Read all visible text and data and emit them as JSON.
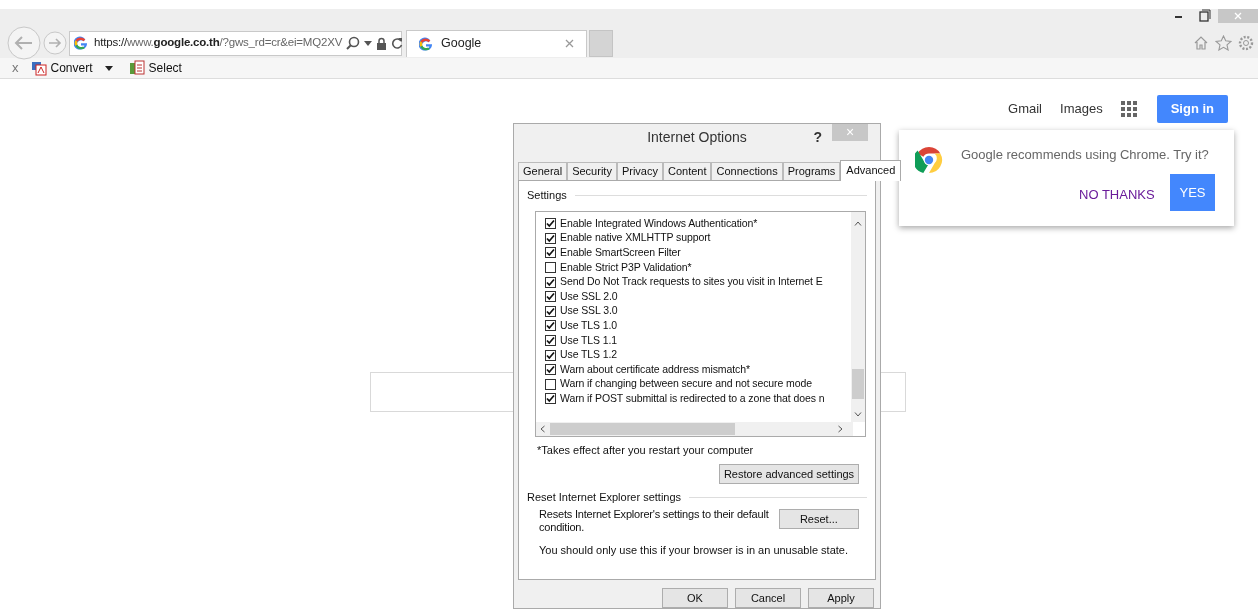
{
  "browser": {
    "address": {
      "scheme": "https://",
      "host_pre": "www.",
      "host": "google.co.th",
      "path": "/?gws_rd=cr&ei=MQ2XV"
    },
    "tabs": [
      {
        "title": "Google",
        "selected": true
      }
    ],
    "toolbar": [
      {
        "kind": "close",
        "label": "x"
      },
      {
        "kind": "convert",
        "label": "Convert"
      },
      {
        "kind": "select",
        "label": "Select"
      }
    ]
  },
  "google": {
    "links": [
      "Gmail",
      "Images"
    ],
    "sign_in": "Sign in",
    "promo": {
      "message": "Google recommends using Chrome. Try it?",
      "decline": "NO THANKS",
      "accept": "YES"
    }
  },
  "dialog": {
    "title": "Internet Options",
    "help": "?",
    "close": "×",
    "tabs": [
      {
        "label": "General",
        "selected": false
      },
      {
        "label": "Security",
        "selected": false
      },
      {
        "label": "Privacy",
        "selected": false
      },
      {
        "label": "Content",
        "selected": false
      },
      {
        "label": "Connections",
        "selected": false
      },
      {
        "label": "Programs",
        "selected": false
      },
      {
        "label": "Advanced",
        "selected": true
      }
    ],
    "settings_label": "Settings",
    "settings": [
      {
        "label": "Enable Integrated Windows Authentication*",
        "checked": true
      },
      {
        "label": "Enable native XMLHTTP support",
        "checked": true
      },
      {
        "label": "Enable SmartScreen Filter",
        "checked": true
      },
      {
        "label": "Enable Strict P3P Validation*",
        "checked": false
      },
      {
        "label": "Send Do Not Track requests to sites you visit in Internet E",
        "checked": true
      },
      {
        "label": "Use SSL 2.0",
        "checked": true
      },
      {
        "label": "Use SSL 3.0",
        "checked": true
      },
      {
        "label": "Use TLS 1.0",
        "checked": true
      },
      {
        "label": "Use TLS 1.1",
        "checked": true
      },
      {
        "label": "Use TLS 1.2",
        "checked": true
      },
      {
        "label": "Warn about certificate address mismatch*",
        "checked": true
      },
      {
        "label": "Warn if changing between secure and not secure mode",
        "checked": false
      },
      {
        "label": "Warn if POST submittal is redirected to a zone that does n",
        "checked": true
      }
    ],
    "restart_note": "*Takes effect after you restart your computer",
    "restore_button": "Restore advanced settings",
    "reset_group": "Reset Internet Explorer settings",
    "reset_text": "Resets Internet Explorer's settings to their default condition.",
    "reset_button": "Reset...",
    "warning": "You should only use this if your browser is in an unusable state.",
    "buttons": [
      "OK",
      "Cancel",
      "Apply"
    ]
  }
}
